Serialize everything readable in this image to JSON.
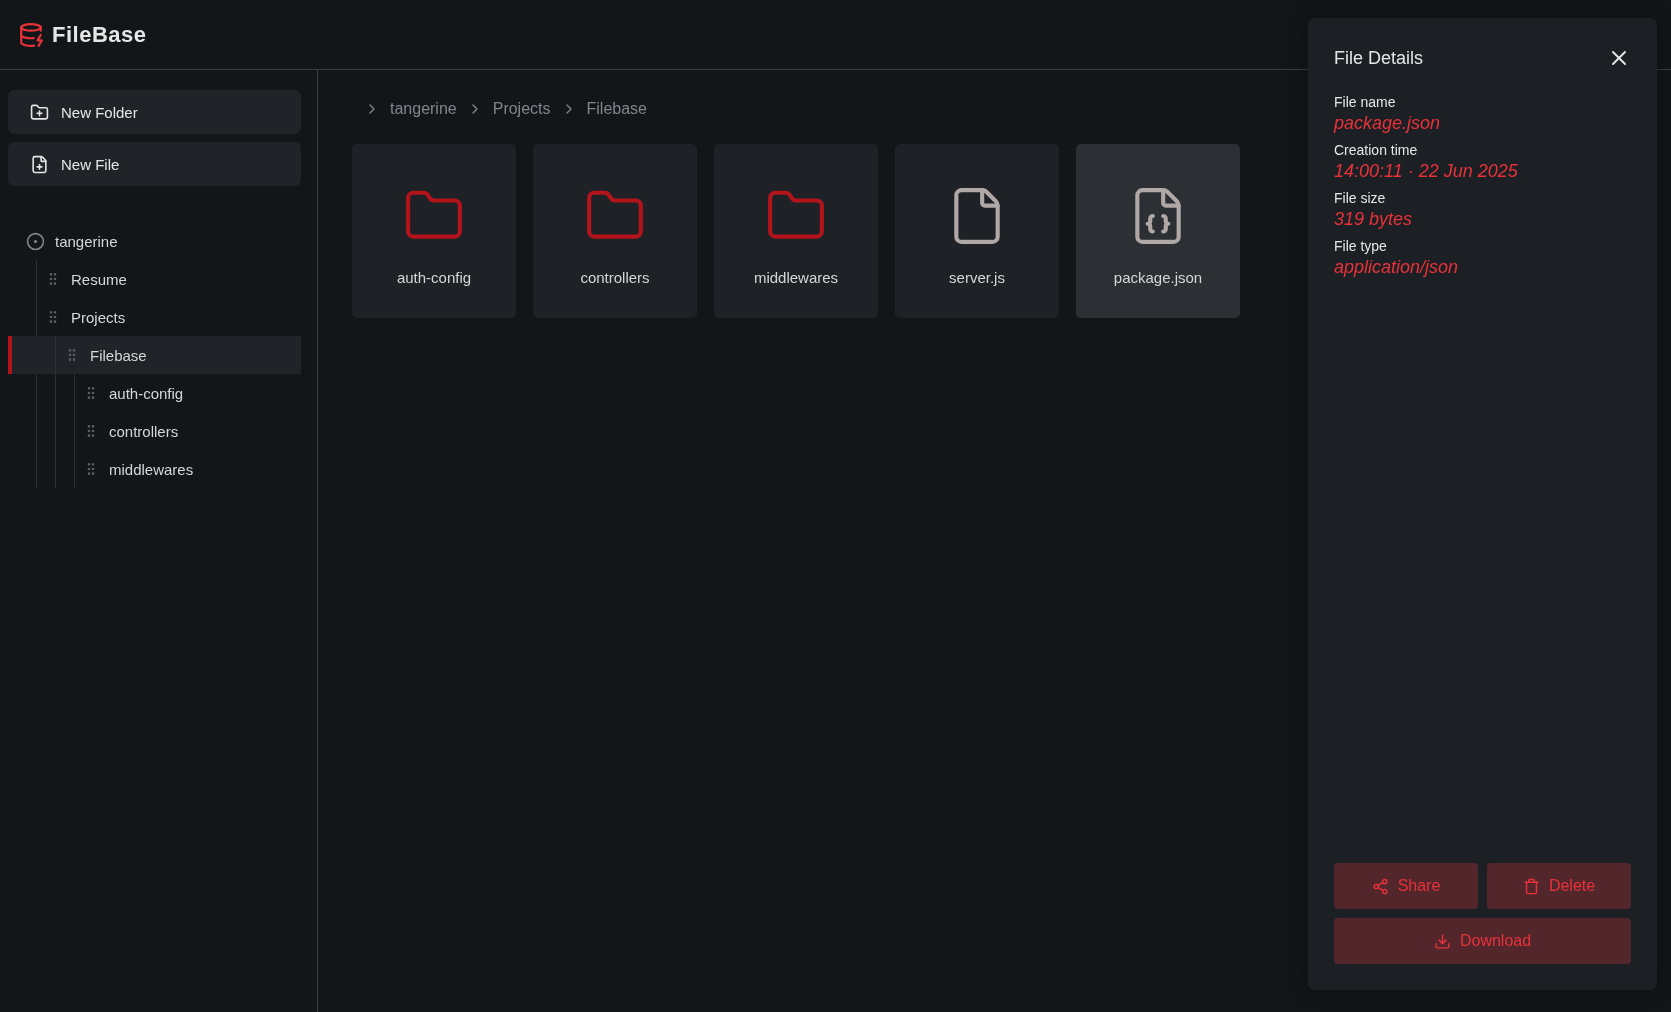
{
  "app": {
    "name": "FileBase"
  },
  "sidebar": {
    "actions": [
      {
        "kind": "folder",
        "label": "New Folder"
      },
      {
        "kind": "file",
        "label": "New File"
      }
    ],
    "tree": [
      {
        "label": "tangerine",
        "selected": false,
        "children": [
          {
            "label": "Resume",
            "selected": false
          },
          {
            "label": "Projects",
            "selected": false,
            "children": [
              {
                "label": "Filebase",
                "selected": true,
                "children": [
                  {
                    "label": "auth-config",
                    "selected": false
                  },
                  {
                    "label": "controllers",
                    "selected": false
                  },
                  {
                    "label": "middlewares",
                    "selected": false
                  }
                ]
              }
            ]
          }
        ]
      }
    ]
  },
  "breadcrumb": [
    "tangerine",
    "Projects",
    "Filebase"
  ],
  "items": [
    {
      "kind": "folder",
      "name": "auth-config",
      "selected": false
    },
    {
      "kind": "folder",
      "name": "controllers",
      "selected": false
    },
    {
      "kind": "folder",
      "name": "middlewares",
      "selected": false
    },
    {
      "kind": "file",
      "name": "server.js",
      "selected": false
    },
    {
      "kind": "json",
      "name": "package.json",
      "selected": true
    }
  ],
  "details": {
    "title": "File Details",
    "fields": [
      {
        "label": "File name",
        "value": "package.json"
      },
      {
        "label": "Creation time",
        "value": "14:00:11 · 22 Jun 2025"
      },
      {
        "label": "File size",
        "value": "319 bytes"
      },
      {
        "label": "File type",
        "value": "application/json"
      }
    ],
    "actions": [
      {
        "kind": "share",
        "label": "Share"
      },
      {
        "kind": "delete",
        "label": "Delete"
      },
      {
        "kind": "download",
        "label": "Download"
      }
    ]
  }
}
